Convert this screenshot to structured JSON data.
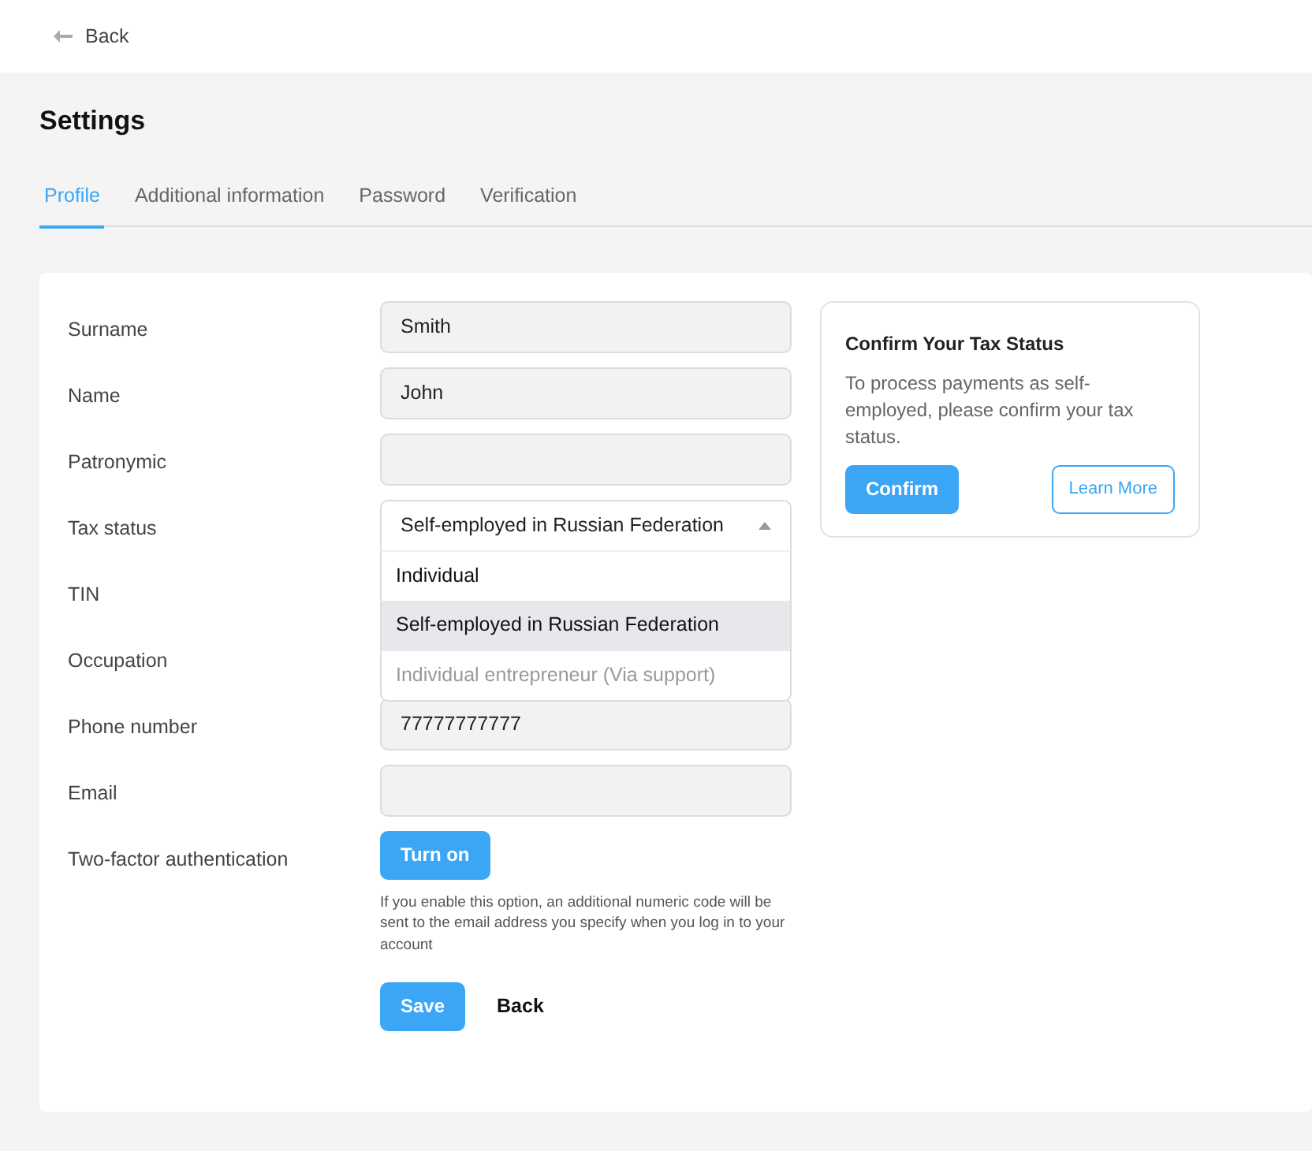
{
  "top_bar": {
    "back_link": "Back"
  },
  "page_title": "Settings",
  "tabs": [
    {
      "label": "Profile",
      "selected": true
    },
    {
      "label": "Additional information",
      "selected": false
    },
    {
      "label": "Password",
      "selected": false
    },
    {
      "label": "Verification",
      "selected": false
    }
  ],
  "form": {
    "rows": [
      {
        "label": "Surname",
        "field": {
          "kind": "text",
          "value": "Smith"
        }
      },
      {
        "label": "Name",
        "field": {
          "kind": "text",
          "value": "John"
        }
      },
      {
        "label": "Patronymic",
        "field": {
          "kind": "text"
        }
      },
      {
        "label": "Tax status",
        "field": {
          "kind": "select",
          "value": "Self-employed in Russian Federation",
          "expanded": true,
          "options": [
            {
              "label": "Individual",
              "selected": false,
              "disabled": false
            },
            {
              "label": "Self-employed in Russian Federation",
              "selected": true,
              "disabled": false
            },
            {
              "label": "Individual entrepreneur (Via support)",
              "selected": false,
              "disabled": true
            }
          ]
        }
      },
      {
        "label": "TIN",
        "field": {
          "kind": "covered"
        }
      },
      {
        "label": "Occupation",
        "field": {
          "kind": "covered"
        }
      },
      {
        "label": "Phone number",
        "field": {
          "kind": "text",
          "value": "77777777777"
        }
      },
      {
        "label": "Email",
        "field": {
          "kind": "text"
        }
      },
      {
        "label": "Two-factor authentication",
        "field": {
          "kind": "button",
          "label": "Turn on",
          "hint": "If you enable this option, an additional numeric code will be sent to the email address you specify when you log in to your account"
        }
      }
    ],
    "save_button": "Save",
    "back_button": "Back"
  },
  "tax_card": {
    "title": "Confirm Your Tax Status",
    "text": "To process payments as self-employed, please confirm your tax status.",
    "confirm_button": "Confirm",
    "learn_more_button": "Learn More"
  }
}
